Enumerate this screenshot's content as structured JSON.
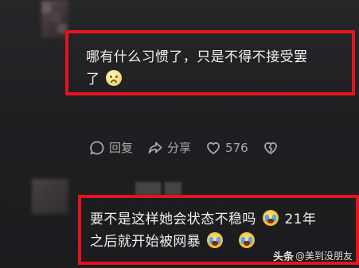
{
  "comment1": {
    "text_line1": "哪有什么习惯了，只是不得不接受罢",
    "text_line2": "了",
    "emoji": "sad-face-icon"
  },
  "actions": {
    "reply_label": "回复",
    "share_label": "分享",
    "like_count": "576"
  },
  "comment2": {
    "text_line1": "要不是这样她会状态不稳吗",
    "text_line1_tail": "21年",
    "text_line2": "之后就开始被网暴",
    "emoji": "crying-face-icon"
  },
  "watermark": {
    "brand": "头条",
    "author": "@美到没朋友"
  },
  "colors": {
    "highlight": "#e8121b",
    "background": "#1d1d20",
    "text": "#f0f0f0",
    "muted": "#a9a9ab"
  }
}
